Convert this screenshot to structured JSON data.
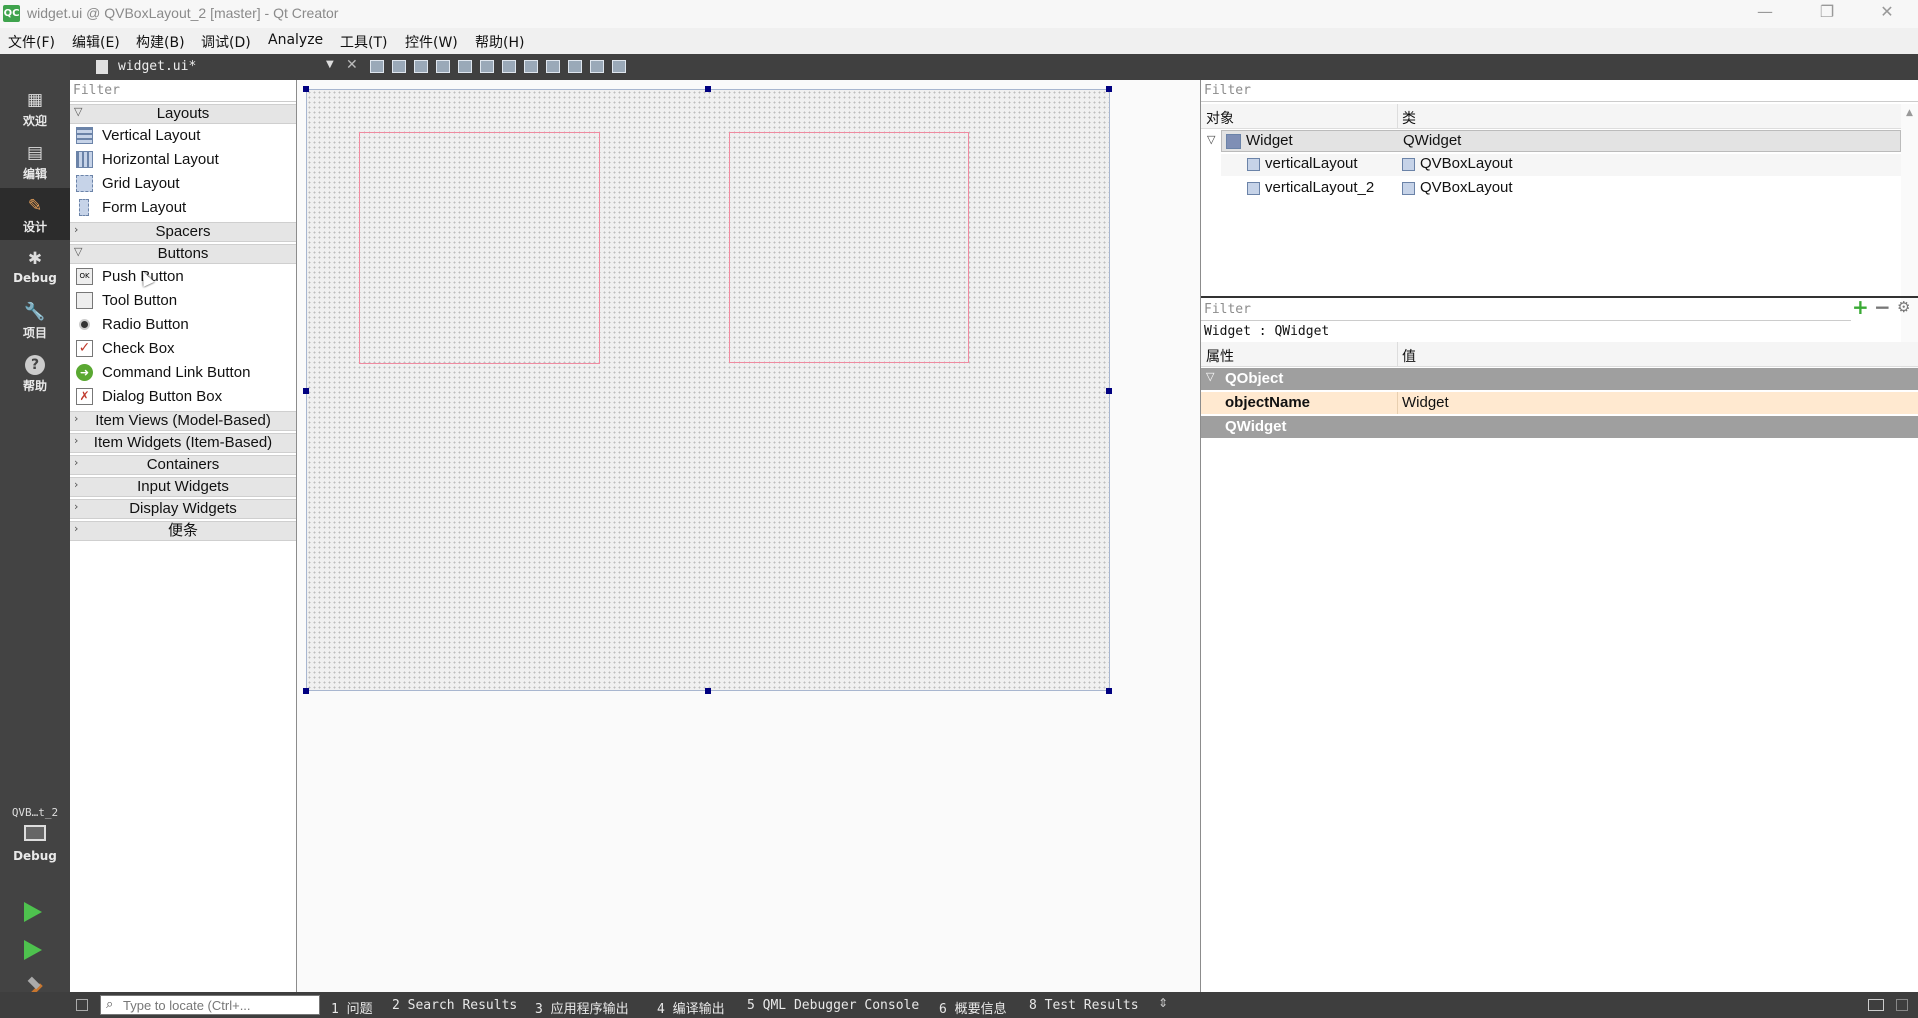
{
  "window": {
    "title": "widget.ui @ QVBoxLayout_2 [master] - Qt Creator",
    "app_icon": "QC",
    "controls": [
      "—",
      "❐",
      "✕"
    ]
  },
  "menu": [
    "文件(F)",
    "编辑(E)",
    "构建(B)",
    "调试(D)",
    "Analyze",
    "工具(T)",
    "控件(W)",
    "帮助(H)"
  ],
  "modes": {
    "items": [
      {
        "label": "欢迎",
        "icon": "grid-icon",
        "glyph": "▦"
      },
      {
        "label": "编辑",
        "icon": "document-icon",
        "glyph": "▤"
      },
      {
        "label": "设计",
        "icon": "pencil-icon",
        "glyph": "✎"
      },
      {
        "label": "Debug",
        "icon": "bug-icon",
        "glyph": "✱"
      },
      {
        "label": "项目",
        "icon": "wrench-icon",
        "glyph": "🔧"
      },
      {
        "label": "帮助",
        "icon": "help-icon",
        "glyph": "?"
      }
    ],
    "active": "设计",
    "kit_name": "QVB…t_2",
    "kit_label": "Debug",
    "kit_icon": "monitor-icon",
    "run_icon": "run-icon",
    "debug_run_icon": "debug-run-icon",
    "build_icon": "hammer-icon"
  },
  "editor": {
    "file_name": "widget.ui*"
  },
  "widget_box": {
    "filter_placeholder": "Filter",
    "categories": {
      "layouts": "Layouts",
      "spacers": "Spacers",
      "buttons": "Buttons",
      "item_views": "Item Views (Model-Based)",
      "item_widgets": "Item Widgets (Item-Based)",
      "containers": "Containers",
      "input_widgets": "Input Widgets",
      "display_widgets": "Display Widgets",
      "notes": "便条"
    },
    "layout_items": [
      "Vertical Layout",
      "Horizontal Layout",
      "Grid Layout",
      "Form Layout"
    ],
    "button_items": [
      "Push Button",
      "Tool Button",
      "Radio Button",
      "Check Box",
      "Command Link Button",
      "Dialog Button Box"
    ]
  },
  "object_inspector": {
    "filter_placeholder": "Filter",
    "col_object": "对象",
    "col_class": "类",
    "rows": [
      {
        "object": "Widget",
        "class": "QWidget"
      },
      {
        "object": "verticalLayout",
        "class": "QVBoxLayout"
      },
      {
        "object": "verticalLayout_2",
        "class": "QVBoxLayout"
      }
    ]
  },
  "property_editor": {
    "filter_placeholder": "Filter",
    "context": "Widget : QWidget",
    "col_property": "属性",
    "col_value": "值",
    "group_qobject": "QObject",
    "prop_name": "objectName",
    "prop_value": "Widget",
    "group_qwidget": "QWidget"
  },
  "status_bar": {
    "locate_placeholder": "Type to locate (Ctrl+...",
    "panes": [
      "1 问题",
      "2 Search Results",
      "3 应用程序输出",
      "4 编译输出",
      "5 QML Debugger Console",
      "6 概要信息",
      "8 Test Results"
    ]
  },
  "colors": {
    "sidebar": "#434343",
    "handle": "#000080",
    "layout_outline": "#f08aa0",
    "selected_row": "#ffe9d0"
  }
}
